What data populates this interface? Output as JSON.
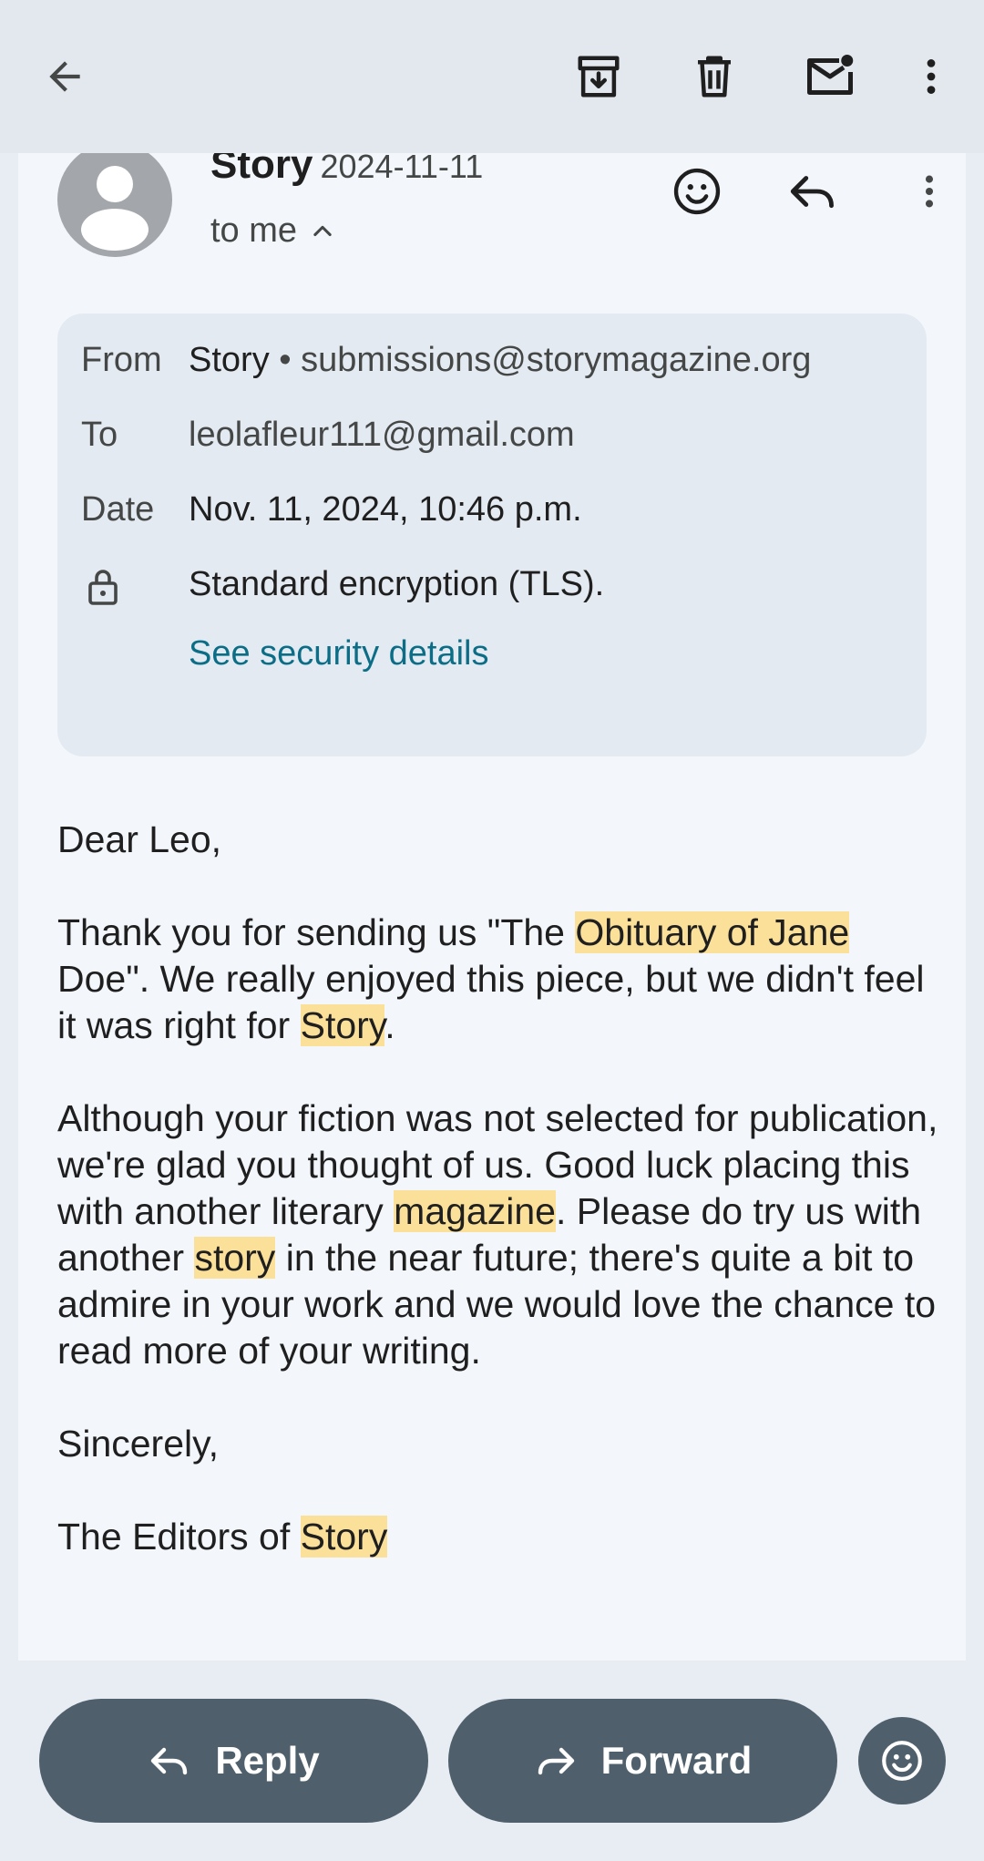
{
  "topbar": {
    "icons": [
      "back-arrow-icon",
      "archive-icon",
      "delete-icon",
      "mark-unread-icon",
      "more-vert-icon"
    ]
  },
  "header": {
    "sender_name": "Story",
    "date_short": "2024-11-11",
    "recipient_summary": "to me",
    "icons": [
      "avatar-icon",
      "emoji-reaction-icon",
      "reply-icon",
      "more-vert-icon"
    ]
  },
  "details": {
    "from_label": "From",
    "from_name": "Story",
    "from_separator": "•",
    "from_email": "submissions@storymagazine.org",
    "to_label": "To",
    "to_email": "leolafleur111@gmail.com",
    "date_label": "Date",
    "date_value": "Nov. 11, 2024, 10:46 p.m.",
    "encryption_text": "Standard encryption (TLS).",
    "security_link": "See security details"
  },
  "body": {
    "greeting": "Dear Leo,",
    "p1_a": "Thank you for sending us \"The ",
    "p1_hl1": "Obituary of Jane",
    "p1_b": " Doe\". We really enjoyed this piece, but we didn't feel it was right for ",
    "p1_hl2": "Story",
    "p1_c": ".",
    "p2_a": "Although your fiction was not selected for publication, we're glad you thought of us. Good luck placing this with another literary ",
    "p2_hl1": "magazine",
    "p2_b": ". Please do try us with another ",
    "p2_hl2": "story",
    "p2_c": " in the near future; there's quite a bit to admire in your work and we would love the chance to read more of your writing.",
    "closing": "Sincerely,",
    "signature_a": "The Editors of ",
    "signature_hl": "Story"
  },
  "bottom": {
    "reply_label": "Reply",
    "forward_label": "Forward"
  },
  "colors": {
    "highlight": "#fbe09a",
    "link": "#0b6e86",
    "button": "#4f5f6b"
  }
}
